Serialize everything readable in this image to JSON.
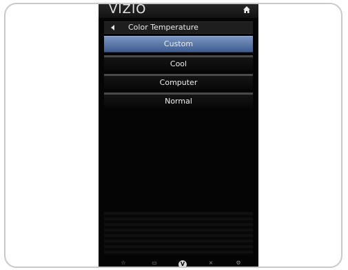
{
  "brand": {
    "logo_text": "VIZIO",
    "home_icon": "home-icon"
  },
  "menu_header": {
    "back_icon": "back-arrow-icon",
    "title": "Color Temperature"
  },
  "menu": {
    "items": [
      {
        "label": "Custom",
        "selected": true
      },
      {
        "label": "Cool",
        "selected": false
      },
      {
        "label": "Computer",
        "selected": false
      },
      {
        "label": "Normal",
        "selected": false
      }
    ]
  },
  "bottom_nav": {
    "items": [
      {
        "icon": "star-icon",
        "glyph": "☆"
      },
      {
        "icon": "input-icon",
        "glyph": "▭"
      },
      {
        "icon": "vizio-v-icon",
        "glyph": "V"
      },
      {
        "icon": "close-icon",
        "glyph": "×"
      },
      {
        "icon": "settings-icon",
        "glyph": "⚙"
      }
    ]
  },
  "colors": {
    "selected_item": "#5f7dae",
    "screen_background": "#050505",
    "frame_border": "#c9c9c9",
    "blue_indicator": "#2f5fb5",
    "red_indicator": "#b54045"
  }
}
